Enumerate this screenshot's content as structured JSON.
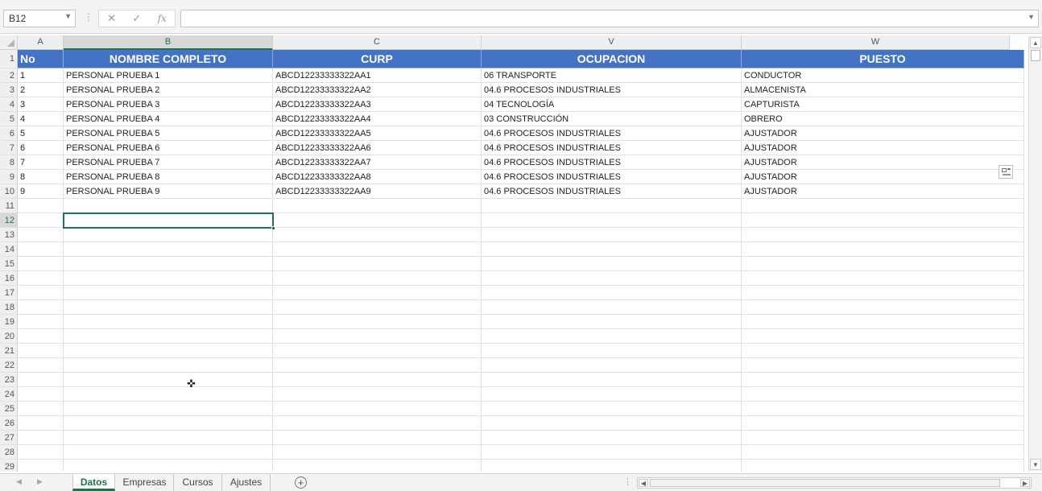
{
  "name_box": {
    "value": "B12"
  },
  "formula_bar": {
    "fx_label": "fx",
    "cancel_glyph": "✕",
    "enter_glyph": "✓",
    "value": ""
  },
  "columns": [
    "A",
    "B",
    "C",
    "V",
    "W"
  ],
  "header_row": [
    "No",
    "NOMBRE COMPLETO",
    "CURP",
    "OCUPACION",
    "PUESTO"
  ],
  "rows": [
    [
      "1",
      "PERSONAL PRUEBA 1",
      "ABCD12233333322AA1",
      "06 TRANSPORTE",
      "CONDUCTOR"
    ],
    [
      "2",
      "PERSONAL PRUEBA 2",
      "ABCD12233333322AA2",
      "04.6 PROCESOS INDUSTRIALES",
      "ALMACENISTA"
    ],
    [
      "3",
      "PERSONAL PRUEBA 3",
      "ABCD12233333322AA3",
      "04 TECNOLOGÍA",
      "CAPTURISTA"
    ],
    [
      "4",
      "PERSONAL PRUEBA 4",
      "ABCD12233333322AA4",
      "03 CONSTRUCCIÓN",
      "OBRERO"
    ],
    [
      "5",
      "PERSONAL PRUEBA 5",
      "ABCD12233333322AA5",
      "04.6 PROCESOS INDUSTRIALES",
      "AJUSTADOR"
    ],
    [
      "6",
      "PERSONAL PRUEBA 6",
      "ABCD12233333322AA6",
      "04.6 PROCESOS INDUSTRIALES",
      "AJUSTADOR"
    ],
    [
      "7",
      "PERSONAL PRUEBA 7",
      "ABCD12233333322AA7",
      "04.6 PROCESOS INDUSTRIALES",
      "AJUSTADOR"
    ],
    [
      "8",
      "PERSONAL PRUEBA 8",
      "ABCD12233333322AA8",
      "04.6 PROCESOS INDUSTRIALES",
      "AJUSTADOR"
    ],
    [
      "9",
      "PERSONAL PRUEBA 9",
      "ABCD12233333322AA9",
      "04.6 PROCESOS INDUSTRIALES",
      "AJUSTADOR"
    ]
  ],
  "row_numbers": [
    "1",
    "2",
    "3",
    "4",
    "5",
    "6",
    "7",
    "8",
    "9",
    "10",
    "11",
    "12",
    "13",
    "14",
    "15",
    "16",
    "17",
    "18",
    "19",
    "20",
    "21",
    "22",
    "23",
    "24",
    "25",
    "26",
    "27",
    "28",
    "29"
  ],
  "selected_cell": {
    "col": "B",
    "row": "12"
  },
  "sheet_tabs": [
    {
      "label": "Datos",
      "active": true
    },
    {
      "label": "Empresas",
      "active": false
    },
    {
      "label": "Cursos",
      "active": false
    },
    {
      "label": "Ajustes",
      "active": false
    }
  ],
  "add_sheet_label": "+",
  "colors": {
    "header_fill": "#4472c4",
    "accent": "#217346"
  },
  "icons": [
    "add-sheet-icon",
    "paste-options-icon",
    "cell-cursor-icon"
  ]
}
